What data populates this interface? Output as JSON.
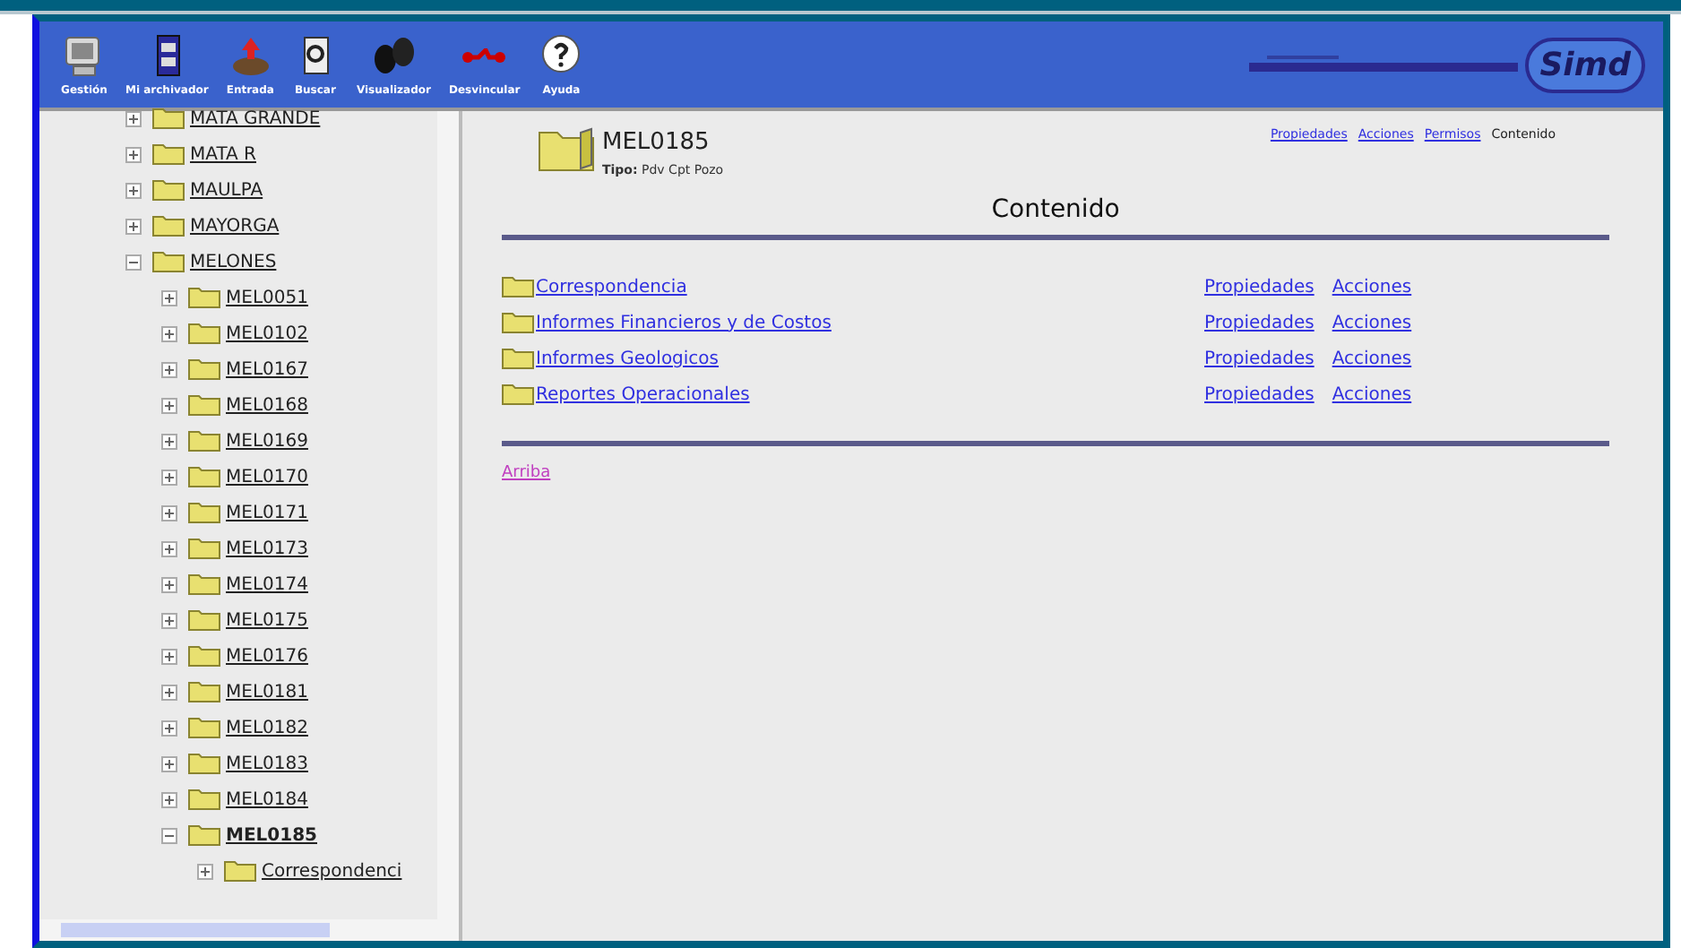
{
  "toolbar": {
    "buttons": [
      {
        "label": "Gestión",
        "kind": "monitor"
      },
      {
        "label": "Mi archivador",
        "kind": "cabinet"
      },
      {
        "label": "Entrada",
        "kind": "inbox"
      },
      {
        "label": "Buscar",
        "kind": "search"
      },
      {
        "label": "Visualizador",
        "kind": "binoculars"
      },
      {
        "label": "Desvincular",
        "kind": "link"
      },
      {
        "label": "Ayuda",
        "kind": "help"
      }
    ],
    "logo": {
      "text": "Simd"
    }
  },
  "tree": [
    {
      "label": "MATA GRANDE",
      "expanded": false,
      "selected": false
    },
    {
      "label": "MATA R",
      "expanded": false,
      "selected": false
    },
    {
      "label": "MAULPA",
      "expanded": false,
      "selected": false
    },
    {
      "label": "MAYORGA",
      "expanded": false,
      "selected": false
    },
    {
      "label": "MELONES",
      "expanded": true,
      "selected": false,
      "children": [
        {
          "label": "MEL0051",
          "expanded": false,
          "selected": false
        },
        {
          "label": "MEL0102",
          "expanded": false,
          "selected": false
        },
        {
          "label": "MEL0167",
          "expanded": false,
          "selected": false
        },
        {
          "label": "MEL0168",
          "expanded": false,
          "selected": false
        },
        {
          "label": "MEL0169",
          "expanded": false,
          "selected": false
        },
        {
          "label": "MEL0170",
          "expanded": false,
          "selected": false
        },
        {
          "label": "MEL0171",
          "expanded": false,
          "selected": false
        },
        {
          "label": "MEL0173",
          "expanded": false,
          "selected": false
        },
        {
          "label": "MEL0174",
          "expanded": false,
          "selected": false
        },
        {
          "label": "MEL0175",
          "expanded": false,
          "selected": false
        },
        {
          "label": "MEL0176",
          "expanded": false,
          "selected": false
        },
        {
          "label": "MEL0181",
          "expanded": false,
          "selected": false
        },
        {
          "label": "MEL0182",
          "expanded": false,
          "selected": false
        },
        {
          "label": "MEL0183",
          "expanded": false,
          "selected": false
        },
        {
          "label": "MEL0184",
          "expanded": false,
          "selected": false
        },
        {
          "label": "MEL0185",
          "expanded": true,
          "selected": true,
          "children": [
            {
              "label": "Correspondenci",
              "expanded": false,
              "selected": false
            }
          ]
        }
      ]
    }
  ],
  "header": {
    "title": "MEL0185",
    "subtitle": "**Tipo:** Pdv Cpt Pozo"
  },
  "nav": [
    {
      "label": "Propiedades",
      "selected": false
    },
    {
      "label": "Acciones",
      "selected": false
    },
    {
      "label": "Permisos",
      "selected": false
    },
    {
      "label": "Contenido",
      "selected": true
    }
  ],
  "section_title": "Contenido",
  "rows": [
    {
      "name": "Correspondencia",
      "properties": "Propiedades",
      "actions": "Acciones"
    },
    {
      "name": "Informes Financieros y de Costos",
      "properties": "Propiedades",
      "actions": "Acciones"
    },
    {
      "name": "Informes Geologicos",
      "properties": "Propiedades",
      "actions": "Acciones"
    },
    {
      "name": "Reportes Operacionales",
      "properties": "Propiedades",
      "actions": "Acciones"
    }
  ],
  "up_link": "Arriba"
}
